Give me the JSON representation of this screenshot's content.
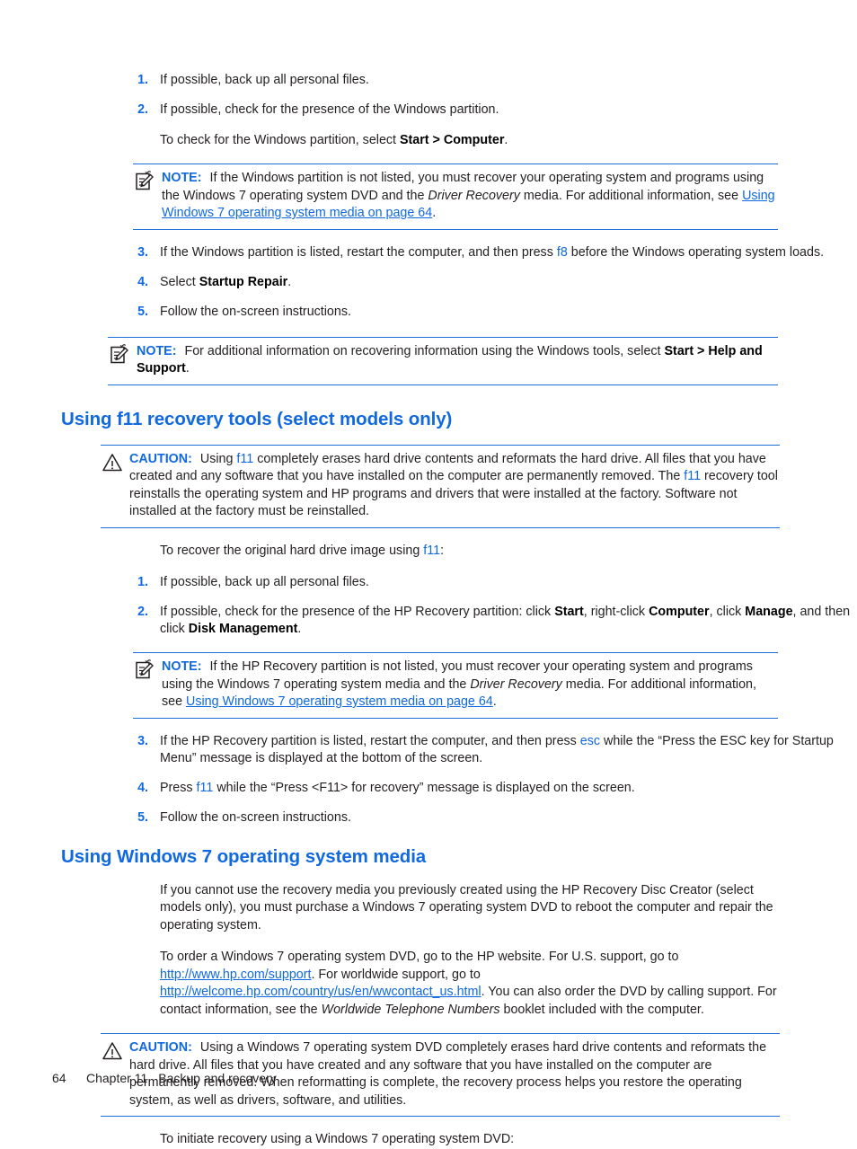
{
  "document": {
    "footer": {
      "page_number": "64",
      "chapter": "Chapter 11",
      "chapter_title": "Backup and recovery"
    }
  },
  "icons": {
    "note": "note-pencil-icon",
    "caution": "warning-triangle-icon"
  },
  "colors": {
    "heading_blue": "#1069e0",
    "link_blue": "#1069e0",
    "rule_blue": "#1a6fe0",
    "body_text": "#231f20"
  },
  "section_windows_tools": {
    "steps": [
      {
        "num": "1.",
        "text": "If possible, back up all personal files."
      },
      {
        "num": "2.",
        "text": "If possible, check for the presence of the Windows partition.",
        "sub_para_prefix": "To check for the Windows partition, select ",
        "sub_para_bold": "Start > Computer",
        "sub_para_suffix": "."
      },
      {
        "num": "3.",
        "text_a": "If the Windows partition is listed, restart the computer, and then press ",
        "key": "f8",
        "text_b": " before the Windows operating system loads."
      },
      {
        "num": "4.",
        "text_a": "Select ",
        "bold": "Startup Repair",
        "text_b": "."
      },
      {
        "num": "5.",
        "text": "Follow the on-screen instructions."
      }
    ],
    "note_1": {
      "label": "NOTE:",
      "text_a": "If the Windows partition is not listed, you must recover your operating system and programs using the Windows 7 operating system DVD and the ",
      "italic": "Driver Recovery",
      "text_b": " media. For additional information, see ",
      "link": "Using Windows 7 operating system media on page 64",
      "text_c": "."
    },
    "note_2": {
      "label": "NOTE:",
      "text_a": "For additional information on recovering information using the Windows tools, select ",
      "bold": "Start > Help and Support",
      "text_b": "."
    }
  },
  "section_f11": {
    "heading": "Using f11 recovery tools (select models only)",
    "caution": {
      "label": "CAUTION:",
      "text_a": "Using ",
      "key_1": "f11",
      "text_b": " completely erases hard drive contents and reformats the hard drive. All files that you have created and any software that you have installed on the computer are permanently removed. The ",
      "key_2": "f11",
      "text_c": " recovery tool reinstalls the operating system and HP programs and drivers that were installed at the factory. Software not installed at the factory must be reinstalled."
    },
    "intro_a": "To recover the original hard drive image using ",
    "intro_key": "f11",
    "intro_b": ":",
    "steps": [
      {
        "num": "1.",
        "text": "If possible, back up all personal files."
      },
      {
        "num": "2.",
        "text_a": "If possible, check for the presence of the HP Recovery partition: click ",
        "bold_1": "Start",
        "text_b": ", right-click ",
        "bold_2": "Computer",
        "text_c": ", click ",
        "bold_3": "Manage",
        "text_d": ", and then click ",
        "bold_4": "Disk Management",
        "text_e": "."
      },
      {
        "num": "3.",
        "text_a": "If the HP Recovery partition is listed, restart the computer, and then press ",
        "key": "esc",
        "text_b": " while the “Press the ESC key for Startup Menu” message is displayed at the bottom of the screen."
      },
      {
        "num": "4.",
        "text_a": "Press ",
        "key": "f11",
        "text_b": " while the “Press <F11> for recovery” message is displayed on the screen."
      },
      {
        "num": "5.",
        "text": "Follow the on-screen instructions."
      }
    ],
    "note": {
      "label": "NOTE:",
      "text_a": "If the HP Recovery partition is not listed, you must recover your operating system and programs using the Windows 7 operating system media and the ",
      "italic": "Driver Recovery",
      "text_b": " media. For additional information, see ",
      "link": "Using Windows 7 operating system media on page 64",
      "text_c": "."
    }
  },
  "section_win7_media": {
    "heading": "Using Windows 7 operating system media",
    "para_1": "If you cannot use the recovery media you previously created using the HP Recovery Disc Creator (select models only), you must purchase a Windows 7 operating system DVD to reboot the computer and repair the operating system.",
    "para_2": {
      "text_a": "To order a Windows 7 operating system DVD, go to the HP website. For U.S. support, go to ",
      "link_1": "http://www.hp.com/support",
      "text_b": ". For worldwide support, go to ",
      "link_2": "http://welcome.hp.com/country/us/en/wwcontact_us.html",
      "text_c": ". You can also order the DVD by calling support. For contact information, see the ",
      "italic": "Worldwide Telephone Numbers",
      "text_d": " booklet included with the computer."
    },
    "caution": {
      "label": "CAUTION:",
      "text": "Using a Windows 7 operating system DVD completely erases hard drive contents and reformats the hard drive. All files that you have created and any software that you have installed on the computer are permanently removed. When reformatting is complete, the recovery process helps you restore the operating system, as well as drivers, software, and utilities."
    },
    "para_3": "To initiate recovery using a Windows 7 operating system DVD:"
  }
}
